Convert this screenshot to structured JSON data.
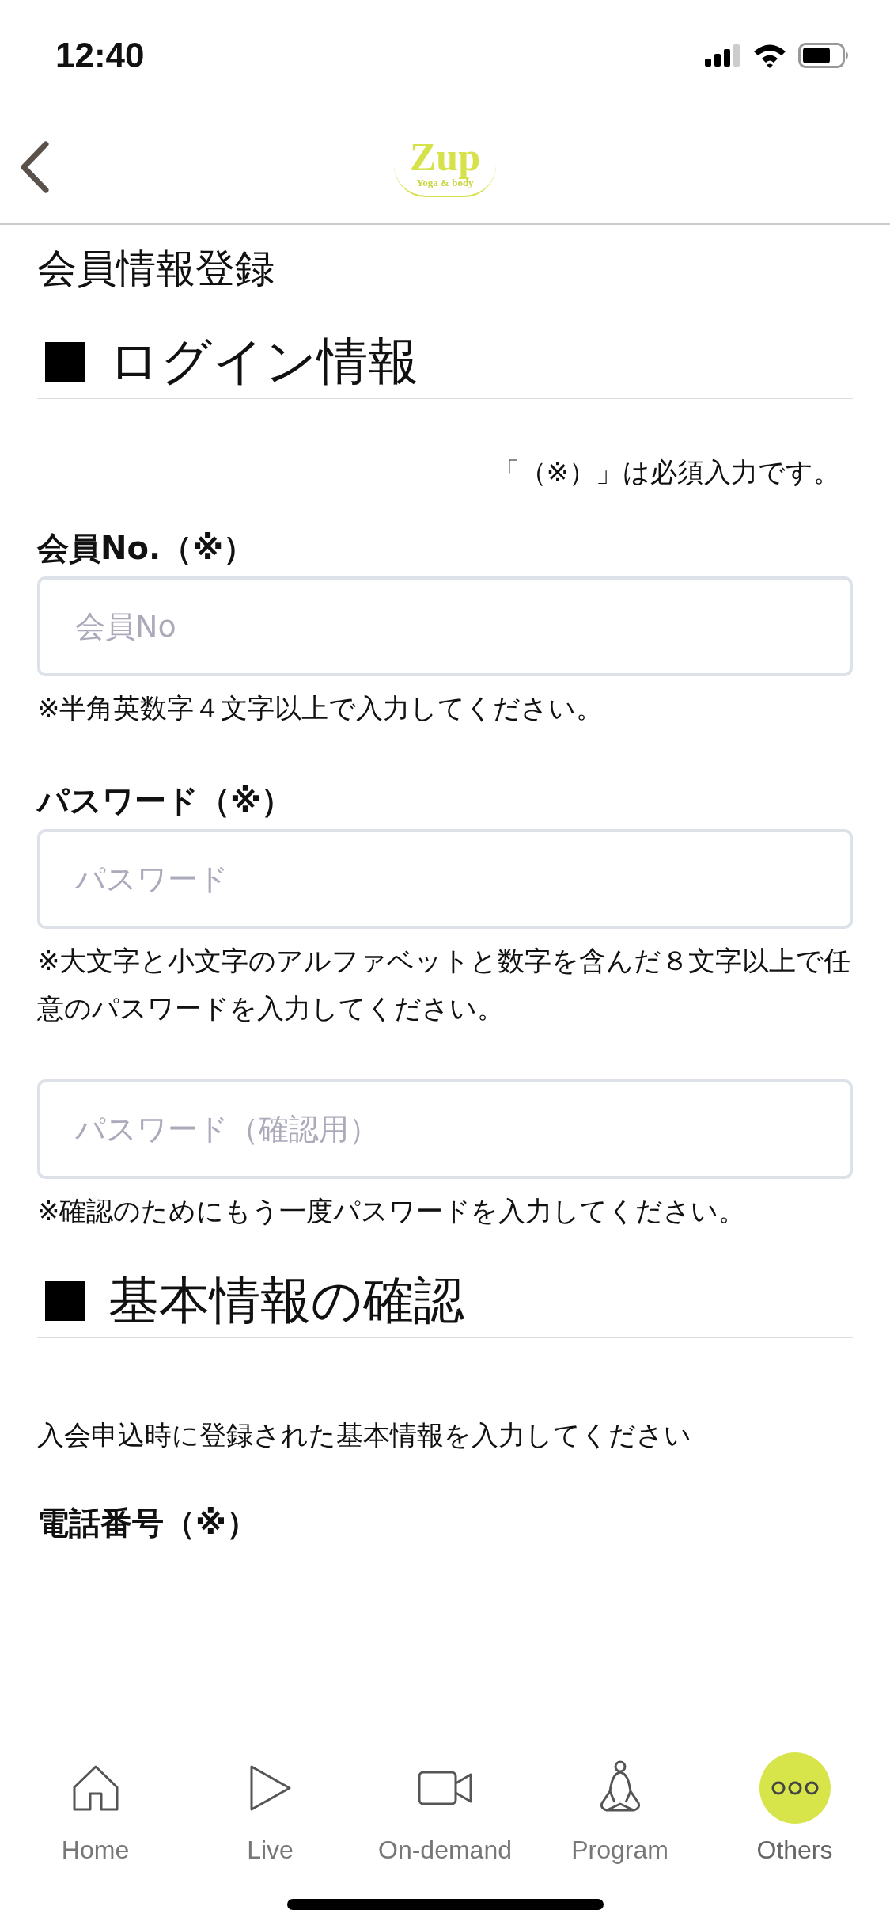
{
  "status_bar": {
    "time": "12:40"
  },
  "nav": {
    "logo": {
      "name": "Zup",
      "tagline": "Yoga & body"
    }
  },
  "page_title": "会員情報登録",
  "sections": [
    {
      "heading": "ログイン情報",
      "required_note": "「（※）」は必須入力です。",
      "fields": [
        {
          "label": "会員No.（※）",
          "placeholder": "会員No",
          "hint": "※半角英数字４文字以上で入力してください。"
        },
        {
          "label": "パスワード（※）",
          "placeholder": "パスワード",
          "hint": "※大文字と小文字のアルファベットと数字を含んだ８文字以上で任意のパスワードを入力してください。"
        },
        {
          "placeholder": "パスワード（確認用）",
          "hint": "※確認のためにもう一度パスワードを入力してください。"
        }
      ]
    },
    {
      "heading": "基本情報の確認",
      "intro": "入会申込時に登録された基本情報を入力してください",
      "fields": [
        {
          "label": "電話番号（※）"
        }
      ]
    }
  ],
  "tab_bar": [
    {
      "label": "Home",
      "selected": false
    },
    {
      "label": "Live",
      "selected": false
    },
    {
      "label": "On-demand",
      "selected": false
    },
    {
      "label": "Program",
      "selected": false
    },
    {
      "label": "Others",
      "selected": true
    }
  ]
}
